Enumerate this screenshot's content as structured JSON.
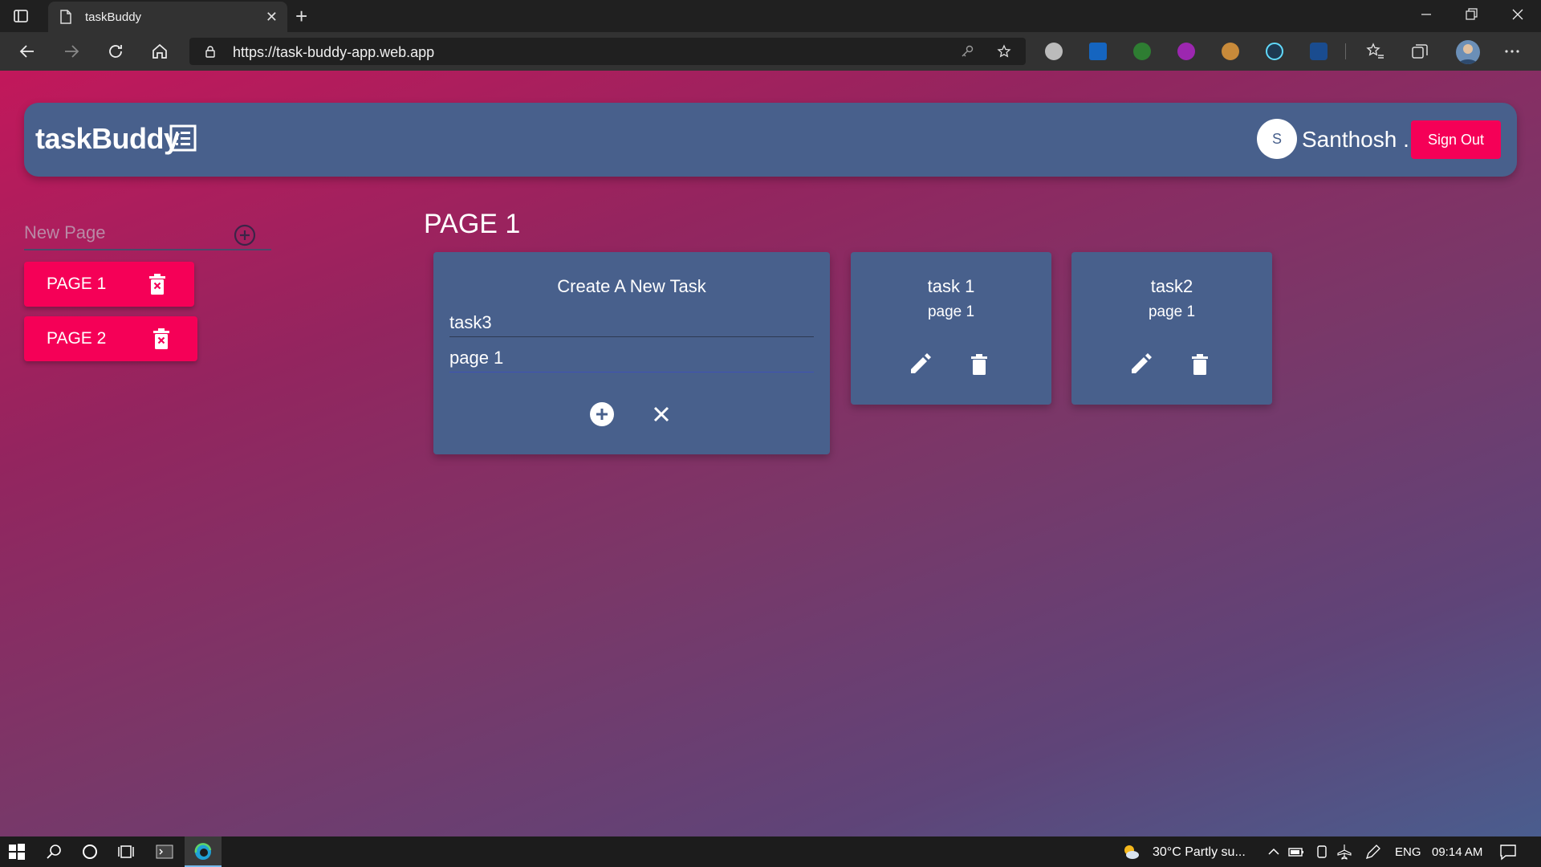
{
  "browser": {
    "tab_title": "taskBuddy",
    "url": "https://task-buddy-app.web.app"
  },
  "app": {
    "brand": "taskBuddy",
    "user": {
      "initial": "S",
      "name": "Santhosh ."
    },
    "signout_label": "Sign Out",
    "new_page_placeholder": "New Page",
    "pages": [
      {
        "label": "PAGE 1"
      },
      {
        "label": "PAGE 2"
      }
    ],
    "current_page_title": "PAGE 1",
    "create_task": {
      "title": "Create A New Task",
      "task_value": "task3",
      "page_value": "page 1"
    },
    "tasks": [
      {
        "title": "task 1",
        "page": "page 1"
      },
      {
        "title": "task2",
        "page": "page 1"
      }
    ],
    "colors": {
      "header": "#48608c",
      "accent": "#f50057",
      "card": "#48608c"
    }
  },
  "taskbar": {
    "weather": "30°C  Partly su...",
    "language": "ENG",
    "time": "09:14 AM"
  }
}
